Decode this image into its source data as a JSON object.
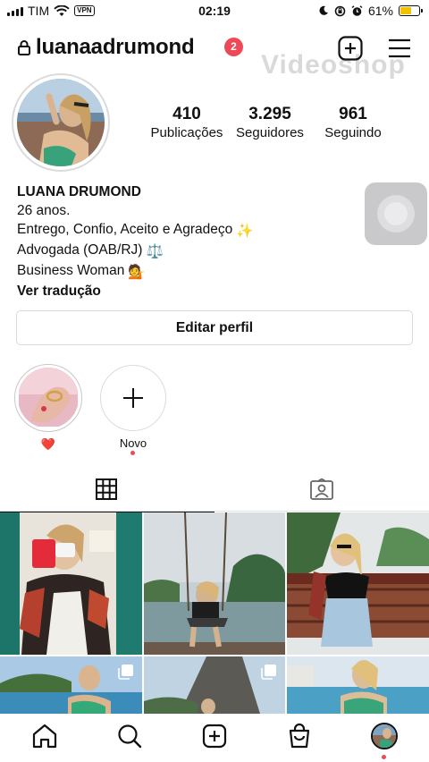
{
  "status_bar": {
    "carrier": "TIM",
    "vpn_label": "VPN",
    "time": "02:19",
    "battery_percent": "61%",
    "battery_level": 0.61,
    "battery_color": "#f2c200"
  },
  "header": {
    "username": "luanaadrumond",
    "notification_count": "2",
    "watermark": "Videoshop"
  },
  "stats": [
    {
      "value": "410",
      "label": "Publicações"
    },
    {
      "value": "3.295",
      "label": "Seguidores"
    },
    {
      "value": "961",
      "label": "Seguindo"
    }
  ],
  "bio": {
    "name": "LUANA DRUMOND",
    "lines": [
      "26 anos.",
      "Entrego, Confio, Aceito e Agradeço",
      "Advogada (OAB/RJ)",
      "Business Woman"
    ],
    "emojis": [
      "✨",
      "⚖️",
      "💁"
    ],
    "translate_link": "Ver tradução"
  },
  "edit_profile_label": "Editar perfil",
  "highlights": [
    {
      "label": "❤️",
      "icon": "heart"
    },
    {
      "label": "Novo",
      "icon": "plus-icon"
    }
  ],
  "tabs": [
    {
      "name": "grid",
      "icon": "grid-icon",
      "active": true
    },
    {
      "name": "tagged",
      "icon": "tagged-icon",
      "active": false
    }
  ],
  "nav": [
    {
      "name": "home",
      "icon": "home-icon"
    },
    {
      "name": "search",
      "icon": "search-icon"
    },
    {
      "name": "create",
      "icon": "create-post-icon"
    },
    {
      "name": "shop",
      "icon": "shop-icon"
    },
    {
      "name": "profile",
      "icon": "profile-avatar"
    }
  ],
  "colors": {
    "accent_red": "#ed4956",
    "border": "#dbdbdb"
  }
}
